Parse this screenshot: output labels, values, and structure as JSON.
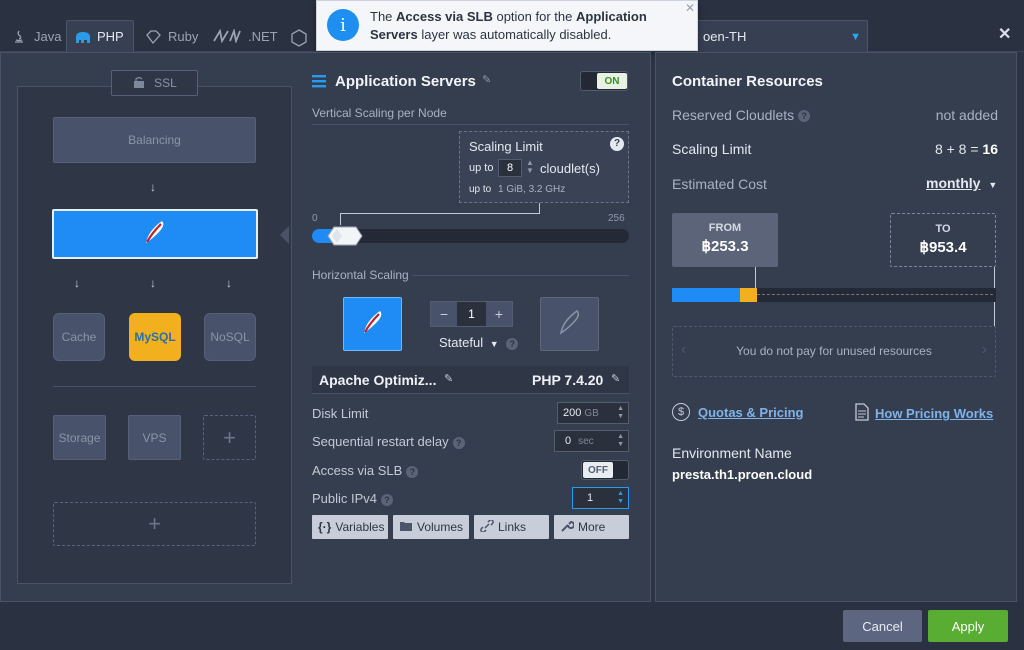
{
  "tabs": [
    {
      "label": "Java",
      "icon": "java-icon"
    },
    {
      "label": "PHP",
      "icon": "php-icon",
      "active": true
    },
    {
      "label": "Ruby",
      "icon": "ruby-icon"
    },
    {
      "label": ".NET",
      "icon": "dotnet-icon"
    }
  ],
  "region": {
    "label": "oen-TH"
  },
  "notification": {
    "pre": "The ",
    "strong1": "Access via SLB",
    "mid": " option for the ",
    "strong2": "Application Servers",
    "post": " layer was automatically disabled."
  },
  "topology": {
    "ssl_label": "SSL",
    "balancing_label": "Balancing",
    "cache_label": "Cache",
    "nosql_label": "NoSQL",
    "mysql_label": "MySQL",
    "storage_label": "Storage",
    "vps_label": "VPS",
    "add_symbol": "+"
  },
  "appservers": {
    "title": "Application Servers",
    "toggle_label": "ON",
    "vertical_scaling_label": "Vertical Scaling per Node",
    "scaling_limit_title": "Scaling Limit",
    "up_to": "up to",
    "cloudlets_value": "8",
    "cloudlets_unit": "cloudlet(s)",
    "up_to_detail_prefix": "up to",
    "up_to_detail": "1 GiB, 3.2 GHz",
    "slider_min": "0",
    "slider_max": "256",
    "horizontal_scaling_label": "Horizontal Scaling",
    "node_count": "1",
    "minus": "−",
    "plus": "+",
    "stateful_label": "Stateful",
    "node_name": "Apache Optimiz...",
    "node_version": "PHP 7.4.20",
    "disk_limit_label": "Disk Limit",
    "disk_limit_value": "200",
    "disk_limit_unit": "GB",
    "restart_delay_label": "Sequential restart delay",
    "restart_delay_value": "0",
    "restart_delay_unit": "sec",
    "slb_label": "Access via SLB",
    "slb_toggle": "OFF",
    "ipv4_label": "Public IPv4",
    "ipv4_value": "1",
    "buttons": {
      "variables": "Variables",
      "volumes": "Volumes",
      "links": "Links",
      "more": "More"
    }
  },
  "resources": {
    "title": "Container Resources",
    "reserved_label": "Reserved Cloudlets",
    "reserved_value": "not added",
    "scaling_limit_label": "Scaling Limit",
    "scaling_limit_expr": "8 + 8 =",
    "scaling_limit_total": "16",
    "estimated_cost_label": "Estimated Cost",
    "period": "monthly",
    "from_label": "FROM",
    "from_value": "฿253.3",
    "to_label": "TO",
    "to_value": "฿953.4",
    "unused_note": "You do not pay for unused resources",
    "quotas_link": "Quotas & Pricing",
    "how_pricing_link": "How Pricing Works",
    "env_name_label": "Environment Name",
    "env_name_value": "presta.th1.proen.cloud"
  },
  "footer": {
    "cancel": "Cancel",
    "apply": "Apply"
  },
  "colors": {
    "accent_blue": "#1f8cf5",
    "apply_green": "#5aad33",
    "toggle_on": "#9be06a"
  }
}
